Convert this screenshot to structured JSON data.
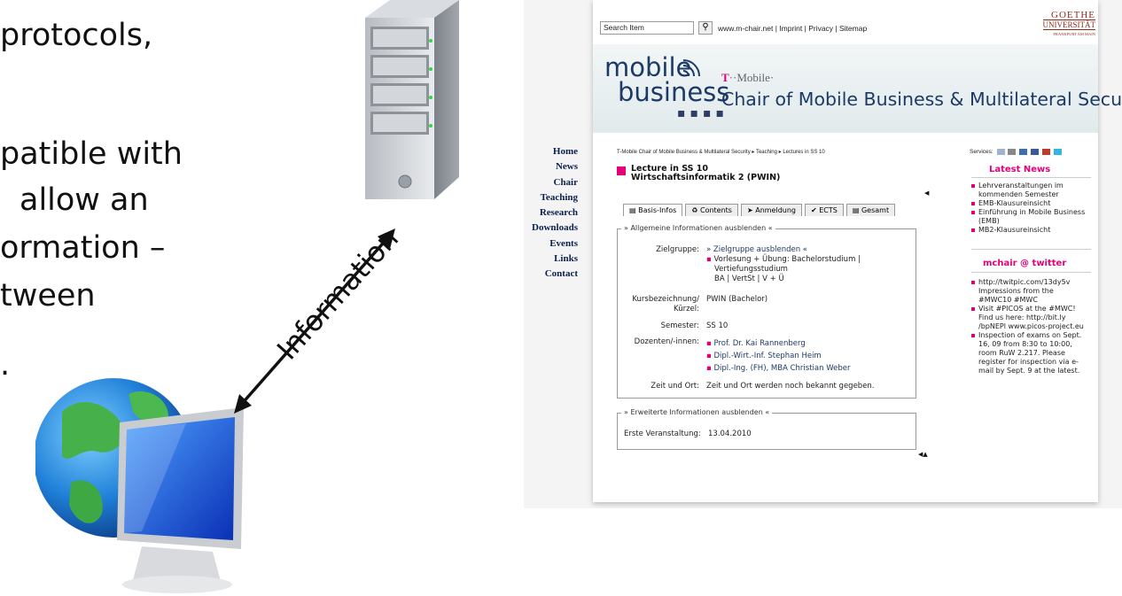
{
  "slide": {
    "lines": [
      "protocols,",
      "patible with",
      "allow an",
      "ormation –",
      "tween",
      "."
    ],
    "arrow_label": "Information"
  },
  "site": {
    "search": {
      "value": "Search Item"
    },
    "top_links": "www.m-chair.net | Imprint | Privacy | Sitemap",
    "goethe": {
      "line1": "GOETHE",
      "line2": "UNIVERSITÄT",
      "line3": "FRANKFURT AM MAIN"
    },
    "logo": {
      "line1": "mobile",
      "line2": "business"
    },
    "tmobile": {
      "t": "T",
      "text": "··Mobile·"
    },
    "chair_title": "Chair of Mobile Business & Multilateral Security",
    "nav": [
      "Home",
      "News",
      "Chair",
      "Teaching",
      "Research",
      "Downloads",
      "Events",
      "Links",
      "Contact"
    ],
    "breadcrumb": "T-Mobile Chair of Mobile Business & Multilateral Security ▸ Teaching ▸ Lectures in SS 10",
    "lecture": {
      "line1": "Lecture in SS 10",
      "line2": "Wirtschaftsinformatik 2 (PWIN)"
    },
    "tabs": [
      {
        "icon": "▤",
        "label": "Basis-Infos"
      },
      {
        "icon": "♻",
        "label": "Contents"
      },
      {
        "icon": "➤",
        "label": "Anmeldung"
      },
      {
        "icon": "✔",
        "label": "ECTS"
      },
      {
        "icon": "▤",
        "label": "Gesamt"
      }
    ],
    "general": {
      "legend": "» Allgemeine Informationen ausblenden «",
      "zielgruppe_label": "Zielgruppe:",
      "zielgruppe_toggle": "» Zielgruppe ausblenden «",
      "zielgruppe_items": [
        "Vorlesung + Übung: Bachelorstudium |",
        "Vertiefungsstudium",
        "BA | VertSt | V + Ü"
      ],
      "kurs_label_1": "Kursbezeichnung/",
      "kurs_label_2": "Kürzel:",
      "kurs_value": "PWIN (Bachelor)",
      "semester_label": "Semester:",
      "semester_value": "SS 10",
      "dozenten_label": "Dozenten/-innen:",
      "dozenten": [
        "Prof. Dr. Kai Rannenberg",
        "Dipl.-Wirt.-Inf. Stephan Heim",
        "Dipl.-Ing. (FH), MBA Christian Weber"
      ],
      "zeit_label": "Zeit und Ort:",
      "zeit_value": "Zeit und Ort werden noch bekannt gegeben."
    },
    "extended": {
      "legend": "» Erweiterte Informationen ausblenden «",
      "erste_label": "Erste Veranstaltung:",
      "erste_value": "13.04.2010"
    },
    "services_label": "Services:",
    "latest_news": {
      "heading": "Latest News",
      "items": [
        "Lehrveranstaltungen im kommenden Semester",
        "EMB-Klausureinsicht",
        "Einführung in Mobile Business (EMB)",
        "MB2-Klausureinsicht"
      ]
    },
    "twitter": {
      "heading": "mchair @ twitter",
      "items": [
        "http://twitpic.com/13dy5v Impressions from the #MWC10 #MWC",
        "Visit #PICOS at the #MWC! Find us here: http://bit.ly /bpNEPl www.picos-project.eu",
        "Inspection of exams on Sept. 16, 09 from 8:30 to 10:00, room RuW 2.217. Please register for inspection via e-mail by Sept. 9 at the latest."
      ]
    },
    "glyphs": {
      "left_arrow": "◀",
      "bottom_arrows": "◀▲"
    }
  },
  "colors": {
    "accent": "#e2007a",
    "navy": "#1d3a66"
  }
}
